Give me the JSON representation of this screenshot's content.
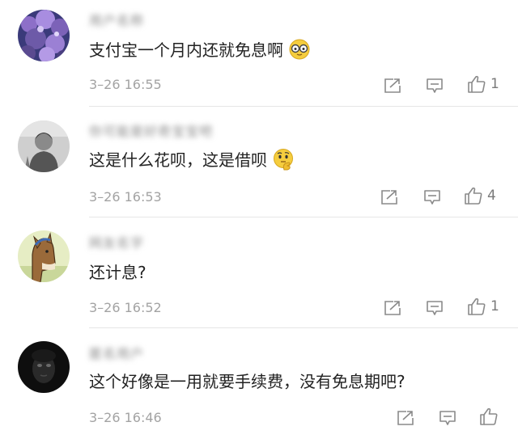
{
  "comments": [
    {
      "username": "用户名称",
      "text": "支付宝一个月内还就免息啊",
      "emoji": "glasses-face-emoji",
      "time": "3–26 16:55",
      "likes": "1"
    },
    {
      "username": "你可能是好奇宝宝吧",
      "text": "这是什么花呗，这是借呗",
      "emoji": "thinking-face-emoji",
      "time": "3–26 16:53",
      "likes": "4"
    },
    {
      "username": "网友名字",
      "text": "还计息?",
      "emoji": "",
      "time": "3–26 16:52",
      "likes": "1"
    },
    {
      "username": "匿名用户",
      "text": "这个好像是一用就要手续费，没有免息期吧?",
      "emoji": "",
      "time": "3–26 16:46",
      "likes": ""
    }
  ],
  "colors": {
    "text": "#222222",
    "meta": "#a3a3a3",
    "icon": "#8a8a8a",
    "divider": "#e6e6e6"
  }
}
